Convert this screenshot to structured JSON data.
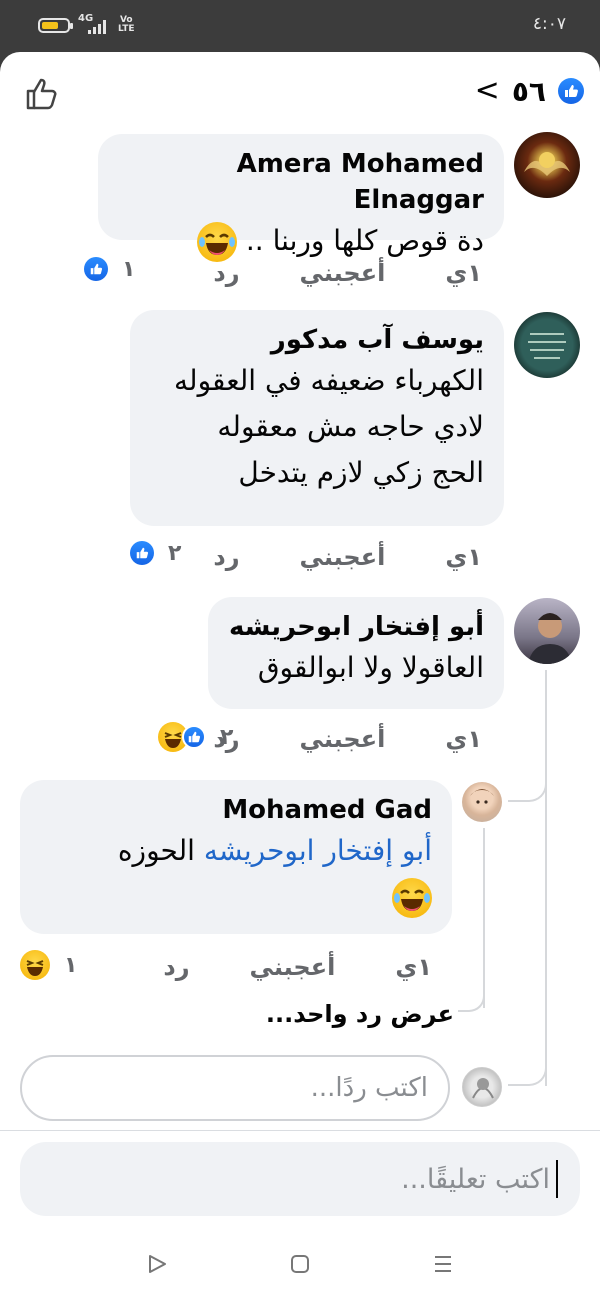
{
  "status_bar": {
    "time": "٤:٠٧",
    "signal": "4G",
    "volte": "Vo LTE"
  },
  "header": {
    "reaction_count": "٥٦",
    "back": "‹"
  },
  "comments": [
    {
      "author": "Amera Mohamed Elnaggar",
      "lines": [
        "دة قوص كلها وربنا .."
      ],
      "time": "١ي",
      "like": "أعجبني",
      "reply": "رد",
      "reaction_count": "١"
    },
    {
      "author": "يوسف آب مدكور",
      "lines": [
        "الكهرباء ضعيفه في العقوله",
        "لادي حاجه مش معقوله",
        "الحج زكي لازم يتدخل"
      ],
      "time": "١ي",
      "like": "أعجبني",
      "reply": "رد",
      "reaction_count": "٢"
    },
    {
      "author": "أبو إفتخار ابوحريشه",
      "lines": [
        "العاقولا ولا ابوالقوق"
      ],
      "time": "١ي",
      "like": "أعجبني",
      "reply": "رد",
      "reaction_count": "٢"
    }
  ],
  "reply": {
    "author": "Mohamed Gad",
    "mention": "أبو إفتخار ابوحريشه",
    "text": " الحوزه",
    "time": "١ي",
    "like": "أعجبني",
    "reply": "رد",
    "reaction_count": "١"
  },
  "view_more_replies": "عرض رد واحد...",
  "reply_input": {
    "placeholder": "اكتب ردًا..."
  },
  "comment_input": {
    "placeholder": "اكتب تعليقًا..."
  },
  "icons": {
    "like": "like-icon",
    "haha": "haha-emoji-icon",
    "thumb": "thumbs-up-outline-icon"
  },
  "colors": {
    "accent": "#1877f2",
    "bubble": "#f0f2f5",
    "mention": "#2067c9"
  }
}
